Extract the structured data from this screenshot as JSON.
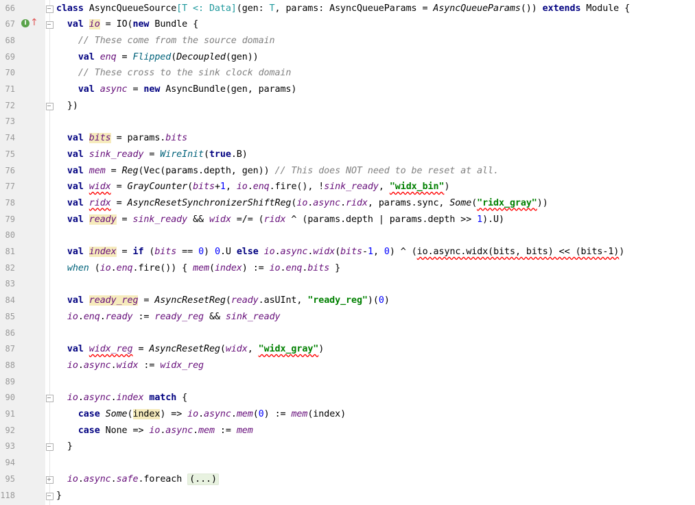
{
  "editor": {
    "language": "Scala",
    "fold_placeholder": "(...)",
    "lines": [
      {
        "number": "66",
        "tokens": [
          [
            "kw",
            "class "
          ],
          [
            "",
            "AsyncQueueSource"
          ],
          [
            "ty",
            "[T <: Data]"
          ],
          [
            "",
            "(gen: "
          ],
          [
            "ty",
            "T"
          ],
          [
            "",
            ", params: AsyncQueueParams = "
          ],
          [
            "it",
            "AsyncQueueParams"
          ],
          [
            "",
            "()) "
          ],
          [
            "kw",
            "extends "
          ],
          [
            "",
            "Module {"
          ]
        ]
      },
      {
        "number": "67",
        "tokens": [
          [
            "kw",
            "  val "
          ],
          [
            "fld hl",
            "io"
          ],
          [
            "",
            " = IO("
          ],
          [
            "kw",
            "new "
          ],
          [
            "",
            "Bundle {"
          ]
        ]
      },
      {
        "number": "68",
        "tokens": [
          [
            "cm",
            "    // These come from the source domain"
          ]
        ]
      },
      {
        "number": "69",
        "tokens": [
          [
            "kw",
            "    val "
          ],
          [
            "fld",
            "enq"
          ],
          [
            "",
            " = "
          ],
          [
            "fn",
            "Flipped"
          ],
          [
            "",
            "("
          ],
          [
            "it",
            "Decoupled"
          ],
          [
            "",
            "(gen))"
          ]
        ]
      },
      {
        "number": "70",
        "tokens": [
          [
            "cm",
            "    // These cross to the sink clock domain"
          ]
        ]
      },
      {
        "number": "71",
        "tokens": [
          [
            "kw",
            "    val "
          ],
          [
            "fld",
            "async"
          ],
          [
            "",
            " = "
          ],
          [
            "kw",
            "new "
          ],
          [
            "",
            "AsyncBundle(gen, params)"
          ]
        ]
      },
      {
        "number": "72",
        "tokens": [
          [
            "",
            "  })"
          ]
        ]
      },
      {
        "number": "73",
        "tokens": []
      },
      {
        "number": "74",
        "tokens": [
          [
            "kw",
            "  val "
          ],
          [
            "fld hl",
            "bits"
          ],
          [
            "",
            " = params."
          ],
          [
            "fld",
            "bits"
          ]
        ]
      },
      {
        "number": "75",
        "tokens": [
          [
            "kw",
            "  val "
          ],
          [
            "fld",
            "sink_ready"
          ],
          [
            "",
            " = "
          ],
          [
            "fn",
            "WireInit"
          ],
          [
            "",
            "("
          ],
          [
            "kw",
            "true"
          ],
          [
            "",
            ".B)"
          ]
        ]
      },
      {
        "number": "76",
        "tokens": [
          [
            "kw",
            "  val "
          ],
          [
            "fld",
            "mem"
          ],
          [
            "",
            " = "
          ],
          [
            "it",
            "Reg"
          ],
          [
            "",
            "(Vec(params.depth, gen)) "
          ],
          [
            "cm",
            "// This does NOT need to be reset at all."
          ]
        ]
      },
      {
        "number": "77",
        "tokens": [
          [
            "kw",
            "  val "
          ],
          [
            "fld sq",
            "widx"
          ],
          [
            "",
            " = "
          ],
          [
            "it",
            "GrayCounter"
          ],
          [
            "",
            "("
          ],
          [
            "fld",
            "bits"
          ],
          [
            "",
            "+"
          ],
          [
            "num",
            "1"
          ],
          [
            "",
            ", "
          ],
          [
            "fld",
            "io"
          ],
          [
            "",
            "."
          ],
          [
            "fld",
            "enq"
          ],
          [
            "",
            ".fire(), !"
          ],
          [
            "fld",
            "sink_ready"
          ],
          [
            "",
            ", "
          ],
          [
            "str sq",
            "\"widx_bin\""
          ],
          [
            "",
            ")"
          ]
        ]
      },
      {
        "number": "78",
        "tokens": [
          [
            "kw",
            "  val "
          ],
          [
            "fld sq",
            "ridx"
          ],
          [
            "",
            " = "
          ],
          [
            "it",
            "AsyncResetSynchronizerShiftReg"
          ],
          [
            "",
            "("
          ],
          [
            "fld",
            "io"
          ],
          [
            "",
            "."
          ],
          [
            "fld",
            "async"
          ],
          [
            "",
            "."
          ],
          [
            "fld",
            "ridx"
          ],
          [
            "",
            ", params.sync, "
          ],
          [
            "it",
            "Some"
          ],
          [
            "",
            "("
          ],
          [
            "str sq",
            "\"ridx_gray\""
          ],
          [
            "",
            "))"
          ]
        ]
      },
      {
        "number": "79",
        "tokens": [
          [
            "kw",
            "  val "
          ],
          [
            "fld hl",
            "ready"
          ],
          [
            "",
            " = "
          ],
          [
            "fld",
            "sink_ready"
          ],
          [
            "",
            " && "
          ],
          [
            "fld",
            "widx"
          ],
          [
            "",
            " =/= ("
          ],
          [
            "fld",
            "ridx"
          ],
          [
            "",
            " ^ (params.depth | params.depth >> "
          ],
          [
            "num",
            "1"
          ],
          [
            "",
            ").U)"
          ]
        ]
      },
      {
        "number": "80",
        "tokens": []
      },
      {
        "number": "81",
        "tokens": [
          [
            "kw",
            "  val "
          ],
          [
            "fld hl",
            "index"
          ],
          [
            "",
            " = "
          ],
          [
            "kw",
            "if "
          ],
          [
            "",
            "("
          ],
          [
            "fld",
            "bits"
          ],
          [
            "",
            " == "
          ],
          [
            "num",
            "0"
          ],
          [
            "",
            ") "
          ],
          [
            "num",
            "0"
          ],
          [
            "",
            ".U "
          ],
          [
            "kw",
            "else "
          ],
          [
            "fld",
            "io"
          ],
          [
            "",
            "."
          ],
          [
            "fld",
            "async"
          ],
          [
            "",
            "."
          ],
          [
            "fld",
            "widx"
          ],
          [
            "",
            "("
          ],
          [
            "fld",
            "bits"
          ],
          [
            "",
            "-"
          ],
          [
            "num",
            "1"
          ],
          [
            "",
            ", "
          ],
          [
            "num",
            "0"
          ],
          [
            "",
            ") ^ ("
          ],
          [
            "sq",
            "io.async.widx(bits, bits) << (bits-1)"
          ],
          [
            "",
            ")"
          ]
        ]
      },
      {
        "number": "82",
        "tokens": [
          [
            "fn",
            "  when "
          ],
          [
            "",
            "("
          ],
          [
            "fld",
            "io"
          ],
          [
            "",
            "."
          ],
          [
            "fld",
            "enq"
          ],
          [
            "",
            ".fire()) { "
          ],
          [
            "fld",
            "mem"
          ],
          [
            "",
            "("
          ],
          [
            "fld",
            "index"
          ],
          [
            "",
            ") := "
          ],
          [
            "fld",
            "io"
          ],
          [
            "",
            "."
          ],
          [
            "fld",
            "enq"
          ],
          [
            "",
            "."
          ],
          [
            "fld",
            "bits"
          ],
          [
            "",
            " }"
          ]
        ]
      },
      {
        "number": "83",
        "tokens": []
      },
      {
        "number": "84",
        "tokens": [
          [
            "kw",
            "  val "
          ],
          [
            "fld hl",
            "ready_reg"
          ],
          [
            "",
            " = "
          ],
          [
            "it",
            "AsyncResetReg"
          ],
          [
            "",
            "("
          ],
          [
            "fld",
            "ready"
          ],
          [
            "",
            ".asUInt, "
          ],
          [
            "str",
            "\"ready_reg\""
          ],
          [
            "",
            ")("
          ],
          [
            "num",
            "0"
          ],
          [
            "",
            ")"
          ]
        ]
      },
      {
        "number": "85",
        "tokens": [
          [
            "fld",
            "  io"
          ],
          [
            "",
            "."
          ],
          [
            "fld",
            "enq"
          ],
          [
            "",
            "."
          ],
          [
            "fld",
            "ready"
          ],
          [
            "",
            " := "
          ],
          [
            "fld",
            "ready_reg"
          ],
          [
            "",
            " && "
          ],
          [
            "fld",
            "sink_ready"
          ]
        ]
      },
      {
        "number": "86",
        "tokens": []
      },
      {
        "number": "87",
        "tokens": [
          [
            "kw",
            "  val "
          ],
          [
            "fld sq",
            "widx_reg"
          ],
          [
            "",
            " = "
          ],
          [
            "it",
            "AsyncResetReg"
          ],
          [
            "",
            "("
          ],
          [
            "fld",
            "widx"
          ],
          [
            "",
            ", "
          ],
          [
            "str sq",
            "\"widx_gray\""
          ],
          [
            "",
            ")"
          ]
        ]
      },
      {
        "number": "88",
        "tokens": [
          [
            "fld",
            "  io"
          ],
          [
            "",
            "."
          ],
          [
            "fld",
            "async"
          ],
          [
            "",
            "."
          ],
          [
            "fld",
            "widx"
          ],
          [
            "",
            " := "
          ],
          [
            "fld",
            "widx_reg"
          ]
        ]
      },
      {
        "number": "89",
        "tokens": []
      },
      {
        "number": "90",
        "tokens": [
          [
            "fld",
            "  io"
          ],
          [
            "",
            "."
          ],
          [
            "fld",
            "async"
          ],
          [
            "",
            "."
          ],
          [
            "fld",
            "index"
          ],
          [
            "kw",
            " match "
          ],
          [
            "",
            "{"
          ]
        ]
      },
      {
        "number": "91",
        "tokens": [
          [
            "kw",
            "    case "
          ],
          [
            "it",
            "Some"
          ],
          [
            "",
            "("
          ],
          [
            "hl",
            "index"
          ],
          [
            "",
            ") => "
          ],
          [
            "fld",
            "io"
          ],
          [
            "",
            "."
          ],
          [
            "fld",
            "async"
          ],
          [
            "",
            "."
          ],
          [
            "fld",
            "mem"
          ],
          [
            "",
            "("
          ],
          [
            "num",
            "0"
          ],
          [
            "",
            ") := "
          ],
          [
            "fld",
            "mem"
          ],
          [
            "",
            "(index)"
          ]
        ]
      },
      {
        "number": "92",
        "tokens": [
          [
            "kw",
            "    case "
          ],
          [
            "",
            "None => "
          ],
          [
            "fld",
            "io"
          ],
          [
            "",
            "."
          ],
          [
            "fld",
            "async"
          ],
          [
            "",
            "."
          ],
          [
            "fld",
            "mem"
          ],
          [
            "",
            " := "
          ],
          [
            "fld",
            "mem"
          ]
        ]
      },
      {
        "number": "93",
        "tokens": [
          [
            "",
            "  }"
          ]
        ]
      },
      {
        "number": "94",
        "tokens": []
      },
      {
        "number": "95",
        "tokens": [
          [
            "fld",
            "  io"
          ],
          [
            "",
            "."
          ],
          [
            "fld",
            "async"
          ],
          [
            "",
            "."
          ],
          [
            "fld",
            "safe"
          ],
          [
            "",
            ".foreach "
          ],
          [
            "collapsed",
            "(...)"
          ]
        ]
      },
      {
        "number": "118",
        "tokens": [
          [
            "",
            "}"
          ]
        ]
      }
    ]
  },
  "gutter_markers": {
    "implements_icon": "implements-marker-icon",
    "override_icon": "up-arrow-icon"
  },
  "colors": {
    "keyword": "#000080",
    "type_param": "#20999d",
    "field": "#660e7a",
    "comment": "#808080",
    "string": "#008000",
    "number": "#0000ff",
    "highlight": "#f6ebbc"
  }
}
